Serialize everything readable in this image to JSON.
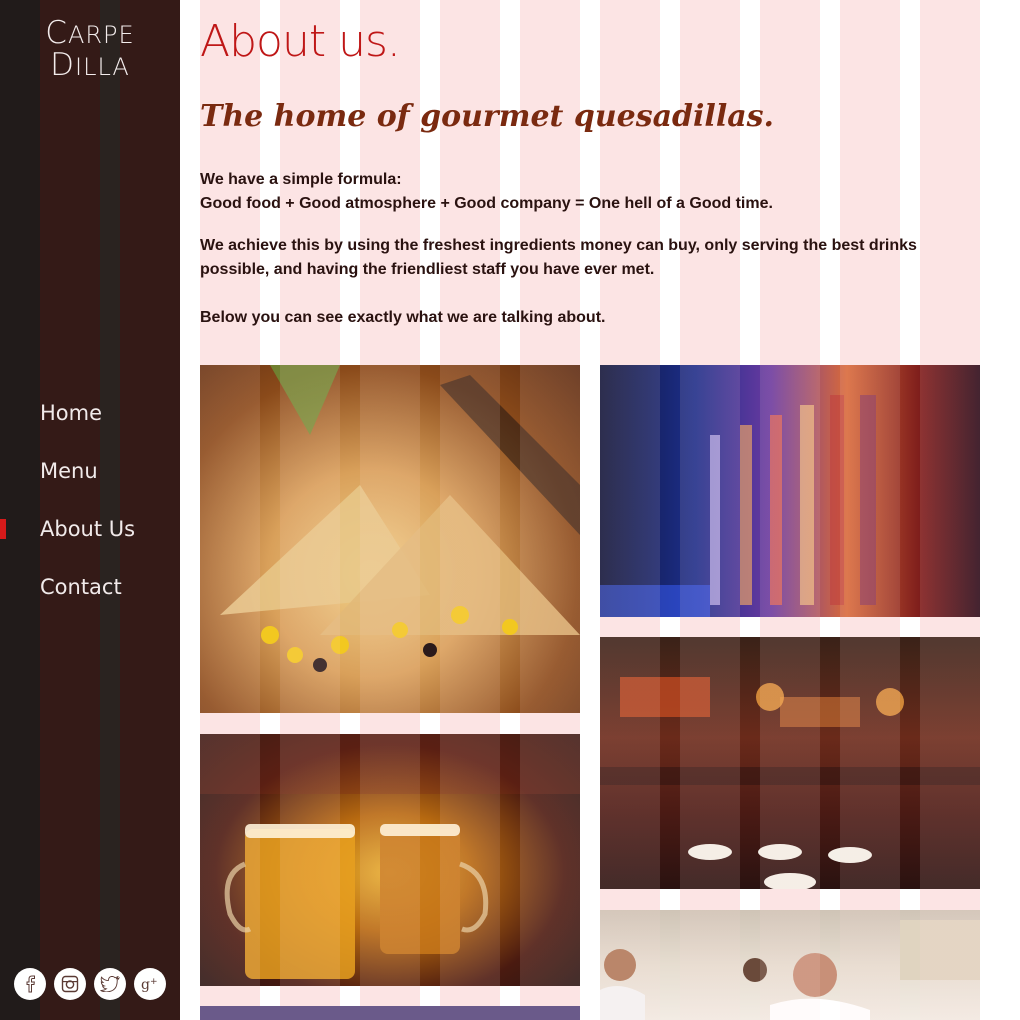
{
  "brand": {
    "logo_line1": "Carpe",
    "logo_line2": "Dilla"
  },
  "nav": {
    "items": [
      {
        "label": "Home",
        "active": false
      },
      {
        "label": "Menu",
        "active": false
      },
      {
        "label": "About Us",
        "active": true
      },
      {
        "label": "Contact",
        "active": false
      }
    ]
  },
  "social": [
    {
      "icon": "facebook-icon"
    },
    {
      "icon": "instagram-icon"
    },
    {
      "icon": "twitter-icon"
    },
    {
      "icon": "google-plus-icon"
    }
  ],
  "main": {
    "title": "About us.",
    "tagline": "The home of gourmet quesadillas.",
    "paragraph1_line1": "We have a simple formula:",
    "paragraph1_line2": "Good food + Good atmosphere + Good company = One hell of a Good time.",
    "paragraph2": "We achieve this by using the freshest ingredients money can buy, only serving the best drinks possible, and having the friendliest staff you have ever met.",
    "paragraph3": "Below you can see exactly what we are talking about."
  },
  "colors": {
    "title": "#bf1717",
    "tagline": "#7a2a10",
    "body_text": "#2a1210",
    "stripe": "#fce4e4",
    "sidebar": "#341a17",
    "active_marker": "#d51a1a"
  }
}
